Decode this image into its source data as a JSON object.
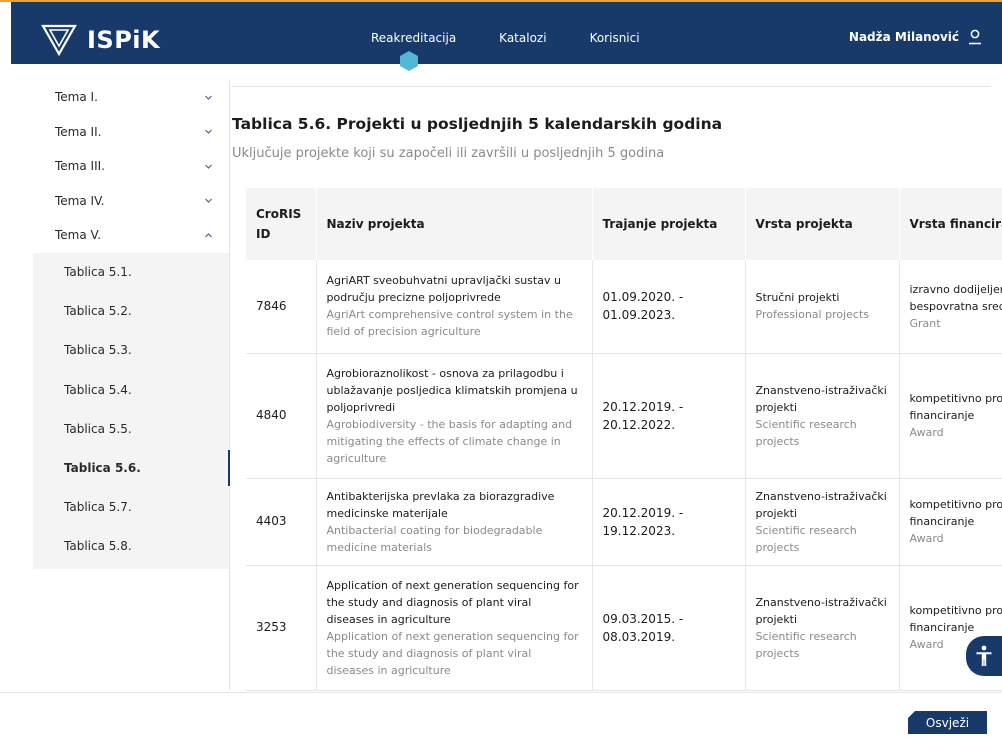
{
  "app": {
    "logo_text": "ISPiK"
  },
  "nav": {
    "items": [
      "Reakreditacija",
      "Katalozi",
      "Korisnici"
    ]
  },
  "user": {
    "name": "Nadža Milanović"
  },
  "sidebar": {
    "themes": [
      "Tema I.",
      "Tema II.",
      "Tema III.",
      "Tema IV.",
      "Tema V."
    ],
    "tables": [
      "Tablica 5.1.",
      "Tablica 5.2.",
      "Tablica 5.3.",
      "Tablica 5.4.",
      "Tablica 5.5.",
      "Tablica 5.6.",
      "Tablica 5.7.",
      "Tablica 5.8."
    ],
    "active_table": "Tablica 5.6."
  },
  "page": {
    "title": "Tablica 5.6. Projekti u posljednjih 5 kalendarskih godina",
    "subtitle": "Uključuje projekte koji su započeli ili završili u posljednjih 5 godina"
  },
  "table": {
    "headers": [
      "CroRIS ID",
      "Naziv projekta",
      "Trajanje projekta",
      "Vrsta projekta",
      "Vrsta financiranja"
    ],
    "rows": [
      {
        "id": "7846",
        "name_hr": "AgriART sveobuhvatni upravljački sustav u području precizne poljoprivrede",
        "name_en": "AgriArt comprehensive control system in the field of precision agriculture",
        "duration_start": "01.09.2020. -",
        "duration_end": "01.09.2023.",
        "type_hr": "Stručni projekti",
        "type_en": "Professional projects",
        "fin_hr_1": "izravno dodijeljena",
        "fin_hr_2": "bespovratna sredstva",
        "fin_en": "Grant"
      },
      {
        "id": "4840",
        "name_hr": "Agrobioraznolikost - osnova za prilagodbu i ublažavanje posljedica klimatskih promjena u poljoprivredi",
        "name_en": "Agrobiodiversity - the basis for adapting and mitigating the effects of climate change in agriculture",
        "duration_start": "20.12.2019. -",
        "duration_end": "20.12.2022.",
        "type_hr": "Znanstveno-istraživački projekti",
        "type_en": "Scientific research projects",
        "fin_hr_1": "kompetitivno projektno",
        "fin_hr_2": "financiranje",
        "fin_en": "Award"
      },
      {
        "id": "4403",
        "name_hr": "Antibakterijska prevlaka za biorazgradive medicinske materijale",
        "name_en": "Antibacterial coating for biodegradable medicine materials",
        "duration_start": "20.12.2019. -",
        "duration_end": "19.12.2023.",
        "type_hr": "Znanstveno-istraživački projekti",
        "type_en": "Scientific research projects",
        "fin_hr_1": "kompetitivno projektno",
        "fin_hr_2": "financiranje",
        "fin_en": "Award"
      },
      {
        "id": "3253",
        "name_hr": "Application of next generation sequencing for the study and diagnosis of plant viral diseases in agriculture",
        "name_en": "Application of next generation sequencing for the study and diagnosis of plant viral diseases in agriculture",
        "duration_start": "09.03.2015. -",
        "duration_end": "08.03.2019.",
        "type_hr": "Znanstveno-istraživački projekti",
        "type_en": "Scientific research projects",
        "fin_hr_1": "kompetitivno projektno",
        "fin_hr_2": "financiranje",
        "fin_en": "Award"
      }
    ]
  },
  "footer": {
    "refresh_label": "Osvježi"
  },
  "colors": {
    "brand": "#173a6a",
    "accent_line": "#e8a23a",
    "hex_marker": "#53b7d6"
  }
}
